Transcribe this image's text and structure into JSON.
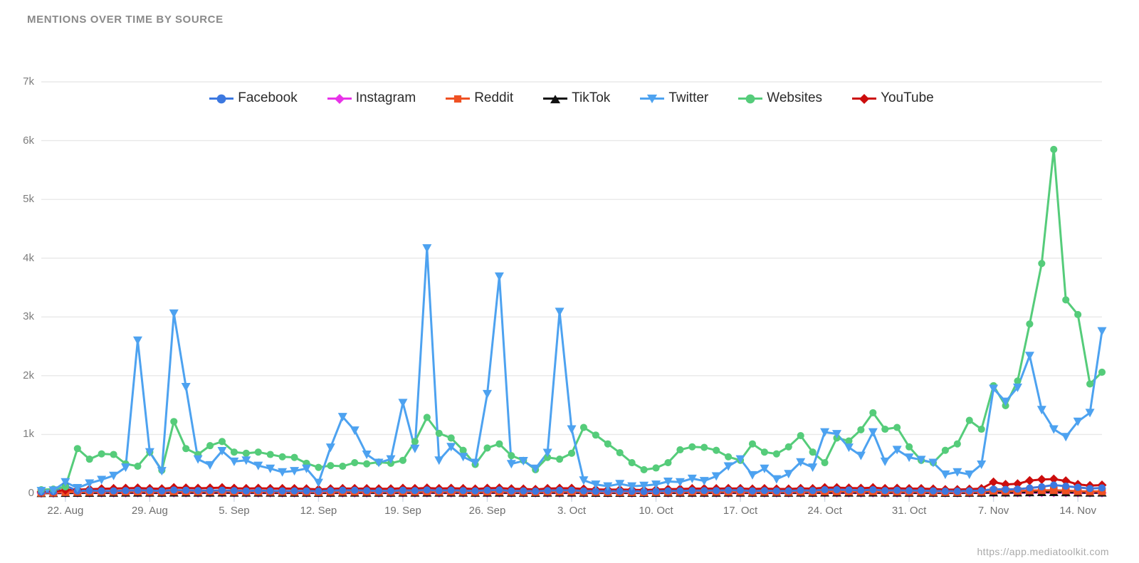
{
  "title": "MENTIONS OVER TIME BY SOURCE",
  "footer": {
    "url": "https://app.mediatoolkit.com"
  },
  "legend": [
    {
      "label": "Facebook",
      "color": "#3c78e0",
      "marker": "circle"
    },
    {
      "label": "Instagram",
      "color": "#e833e8",
      "marker": "diamond"
    },
    {
      "label": "Reddit",
      "color": "#ef5123",
      "marker": "square"
    },
    {
      "label": "TikTok",
      "color": "#111111",
      "marker": "triangle"
    },
    {
      "label": "Twitter",
      "color": "#4da2f0",
      "marker": "triangle-down"
    },
    {
      "label": "Websites",
      "color": "#55cc7a",
      "marker": "circle"
    },
    {
      "label": "YouTube",
      "color": "#cc0d0d",
      "marker": "diamond"
    }
  ],
  "chart_data": {
    "type": "line",
    "title": "MENTIONS OVER TIME BY SOURCE",
    "xlabel": "",
    "ylabel": "",
    "ylim": [
      0,
      7000
    ],
    "yticks": [
      0,
      1000,
      2000,
      3000,
      4000,
      5000,
      6000,
      7000
    ],
    "ytick_labels": [
      "0",
      "1k",
      "2k",
      "3k",
      "4k",
      "5k",
      "6k",
      "7k"
    ],
    "grid": true,
    "legend_position": "top-center",
    "x_start_label": "22. Aug",
    "xtick_labels": [
      "22. Aug",
      "29. Aug",
      "5. Sep",
      "12. Sep",
      "19. Sep",
      "26. Sep",
      "3. Oct",
      "10. Oct",
      "17. Oct",
      "24. Oct",
      "31. Oct",
      "7. Nov",
      "14. Nov"
    ],
    "xtick_indices": [
      2,
      9,
      16,
      23,
      30,
      37,
      44,
      51,
      58,
      65,
      72,
      79,
      86
    ],
    "x": [
      "20. Aug",
      "21. Aug",
      "22. Aug",
      "23. Aug",
      "24. Aug",
      "25. Aug",
      "26. Aug",
      "27. Aug",
      "28. Aug",
      "29. Aug",
      "30. Aug",
      "31. Aug",
      "1. Sep",
      "2. Sep",
      "3. Sep",
      "4. Sep",
      "5. Sep",
      "6. Sep",
      "7. Sep",
      "8. Sep",
      "9. Sep",
      "10. Sep",
      "11. Sep",
      "12. Sep",
      "13. Sep",
      "14. Sep",
      "15. Sep",
      "16. Sep",
      "17. Sep",
      "18. Sep",
      "19. Sep",
      "20. Sep",
      "21. Sep",
      "22. Sep",
      "23. Sep",
      "24. Sep",
      "25. Sep",
      "26. Sep",
      "27. Sep",
      "28. Sep",
      "29. Sep",
      "30. Sep",
      "1. Oct",
      "2. Oct",
      "3. Oct",
      "4. Oct",
      "5. Oct",
      "6. Oct",
      "7. Oct",
      "8. Oct",
      "9. Oct",
      "10. Oct",
      "11. Oct",
      "12. Oct",
      "13. Oct",
      "14. Oct",
      "15. Oct",
      "16. Oct",
      "17. Oct",
      "18. Oct",
      "19. Oct",
      "20. Oct",
      "21. Oct",
      "22. Oct",
      "23. Oct",
      "24. Oct",
      "25. Oct",
      "26. Oct",
      "27. Oct",
      "28. Oct",
      "29. Oct",
      "30. Oct",
      "31. Oct",
      "1. Nov",
      "2. Nov",
      "3. Nov",
      "4. Nov",
      "5. Nov",
      "6. Nov",
      "7. Nov",
      "8. Nov",
      "9. Nov",
      "10. Nov",
      "11. Nov",
      "12. Nov",
      "13. Nov",
      "14. Nov",
      "15. Nov",
      "16. Nov"
    ],
    "series": [
      {
        "name": "Websites",
        "color": "#55cc7a",
        "marker": "circle",
        "values": [
          60,
          70,
          110,
          760,
          580,
          670,
          660,
          500,
          460,
          700,
          390,
          1220,
          760,
          660,
          810,
          880,
          700,
          680,
          700,
          660,
          620,
          610,
          510,
          440,
          470,
          460,
          520,
          500,
          530,
          510,
          560,
          880,
          1290,
          1020,
          940,
          730,
          490,
          770,
          840,
          640,
          560,
          400,
          610,
          580,
          680,
          1120,
          990,
          840,
          690,
          520,
          400,
          430,
          520,
          740,
          790,
          780,
          730,
          620,
          560,
          840,
          700,
          670,
          790,
          980,
          700,
          520,
          940,
          890,
          1080,
          1370,
          1090,
          1120,
          790,
          560,
          520,
          730,
          840,
          1240,
          1090,
          1830,
          1490,
          1910,
          2880,
          3910,
          5850,
          3290,
          3040,
          1860,
          2060
        ]
      },
      {
        "name": "Twitter",
        "color": "#4da2f0",
        "marker": "triangle-down",
        "values": [
          40,
          50,
          190,
          90,
          170,
          230,
          300,
          440,
          2600,
          700,
          380,
          3060,
          1810,
          580,
          480,
          720,
          540,
          560,
          470,
          420,
          360,
          380,
          420,
          180,
          780,
          1300,
          1070,
          660,
          520,
          580,
          1540,
          760,
          4170,
          560,
          790,
          620,
          520,
          1690,
          3690,
          500,
          550,
          420,
          690,
          3090,
          1090,
          220,
          150,
          120,
          160,
          120,
          130,
          150,
          200,
          190,
          250,
          210,
          290,
          460,
          580,
          310,
          420,
          240,
          330,
          530,
          440,
          1040,
          1010,
          780,
          640,
          1040,
          540,
          740,
          610,
          570,
          520,
          320,
          360,
          320,
          490,
          1780,
          1560,
          1800,
          2340,
          1420,
          1090,
          960,
          1220,
          1370,
          2760
        ]
      },
      {
        "name": "Facebook",
        "color": "#3c78e0",
        "marker": "circle",
        "values": [
          20,
          25,
          130,
          40,
          45,
          40,
          40,
          45,
          50,
          45,
          40,
          55,
          50,
          45,
          45,
          50,
          45,
          40,
          45,
          40,
          40,
          40,
          40,
          35,
          45,
          50,
          50,
          45,
          40,
          40,
          50,
          45,
          55,
          45,
          50,
          45,
          40,
          50,
          55,
          40,
          40,
          35,
          45,
          50,
          50,
          40,
          35,
          35,
          35,
          35,
          30,
          35,
          40,
          40,
          45,
          45,
          45,
          50,
          50,
          40,
          45,
          40,
          40,
          50,
          45,
          60,
          60,
          55,
          50,
          60,
          45,
          50,
          45,
          45,
          40,
          35,
          35,
          40,
          45,
          70,
          65,
          70,
          90,
          110,
          140,
          120,
          100,
          80,
          90
        ]
      },
      {
        "name": "YouTube",
        "color": "#cc0d0d",
        "marker": "diamond",
        "values": [
          25,
          30,
          55,
          60,
          70,
          75,
          80,
          85,
          90,
          80,
          75,
          95,
          90,
          85,
          90,
          95,
          85,
          80,
          85,
          80,
          80,
          78,
          75,
          65,
          75,
          80,
          80,
          78,
          75,
          75,
          85,
          80,
          90,
          80,
          85,
          80,
          72,
          85,
          90,
          75,
          72,
          65,
          80,
          85,
          85,
          72,
          65,
          62,
          62,
          60,
          55,
          62,
          70,
          72,
          78,
          78,
          78,
          82,
          80,
          72,
          78,
          72,
          72,
          82,
          78,
          95,
          95,
          90,
          85,
          95,
          80,
          85,
          78,
          78,
          72,
          62,
          62,
          70,
          78,
          190,
          150,
          160,
          215,
          235,
          240,
          210,
          150,
          130,
          140
        ]
      },
      {
        "name": "Reddit",
        "color": "#ef5123",
        "marker": "square",
        "values": [
          8,
          10,
          18,
          20,
          22,
          24,
          25,
          26,
          28,
          25,
          24,
          30,
          28,
          26,
          28,
          30,
          26,
          25,
          26,
          25,
          25,
          24,
          23,
          20,
          24,
          25,
          25,
          24,
          23,
          23,
          26,
          25,
          28,
          25,
          26,
          25,
          22,
          26,
          28,
          23,
          22,
          20,
          25,
          26,
          26,
          22,
          20,
          19,
          19,
          18,
          17,
          19,
          22,
          22,
          24,
          24,
          24,
          25,
          25,
          22,
          24,
          22,
          22,
          25,
          24,
          30,
          30,
          28,
          26,
          30,
          25,
          26,
          24,
          24,
          22,
          19,
          19,
          22,
          24,
          40,
          35,
          36,
          45,
          50,
          52,
          46,
          35,
          30,
          32
        ]
      },
      {
        "name": "TikTok",
        "color": "#111111",
        "marker": "triangle",
        "values": [
          2,
          3,
          5,
          6,
          7,
          8,
          8,
          9,
          10,
          9,
          8,
          11,
          10,
          9,
          10,
          11,
          9,
          9,
          9,
          9,
          8,
          8,
          8,
          7,
          8,
          9,
          9,
          8,
          8,
          8,
          9,
          9,
          10,
          9,
          9,
          9,
          8,
          9,
          10,
          8,
          8,
          7,
          9,
          9,
          9,
          8,
          7,
          7,
          7,
          6,
          6,
          7,
          8,
          8,
          8,
          8,
          8,
          9,
          9,
          8,
          8,
          8,
          8,
          9,
          8,
          11,
          11,
          10,
          9,
          11,
          9,
          9,
          8,
          8,
          8,
          7,
          7,
          8,
          8,
          14,
          12,
          13,
          16,
          18,
          18,
          16,
          12,
          10,
          11
        ]
      },
      {
        "name": "Instagram",
        "color": "#e833e8",
        "marker": "diamond",
        "values": [
          1,
          2,
          3,
          4,
          4,
          5,
          5,
          5,
          6,
          5,
          5,
          6,
          6,
          5,
          6,
          6,
          5,
          5,
          5,
          5,
          5,
          5,
          4,
          4,
          5,
          5,
          5,
          5,
          4,
          4,
          5,
          5,
          6,
          5,
          5,
          5,
          4,
          5,
          6,
          4,
          4,
          4,
          5,
          5,
          5,
          4,
          4,
          4,
          4,
          3,
          3,
          4,
          4,
          4,
          5,
          5,
          5,
          5,
          5,
          4,
          5,
          4,
          4,
          5,
          5,
          6,
          6,
          6,
          5,
          6,
          5,
          5,
          5,
          5,
          4,
          4,
          4,
          4,
          5,
          8,
          7,
          7,
          9,
          10,
          10,
          9,
          7,
          6,
          6
        ]
      }
    ]
  }
}
